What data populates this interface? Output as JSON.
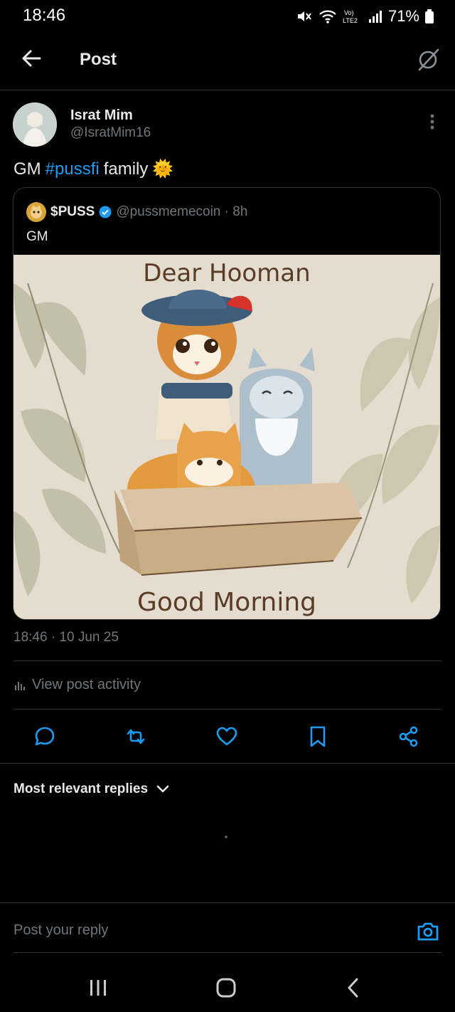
{
  "status_bar": {
    "time": "18:46",
    "battery": "71%",
    "network_label": "Vo) LTE2"
  },
  "header": {
    "title": "Post",
    "back_icon": "arrow-left-icon",
    "grok_icon": "grok-icon"
  },
  "post": {
    "author_name": "Israt Mim",
    "author_handle": "@IsratMim16",
    "text_before": "GM",
    "hashtag": "#pussfi",
    "text_after": "family",
    "emoji": "🌞",
    "timestamp": "18:46 · 10 Jun 25",
    "activity_label": "View post activity"
  },
  "quote": {
    "name": "$PUSS",
    "handle_time": "@pussmemecoin · 8h",
    "text": "GM",
    "image_title_top": "Dear Hooman",
    "image_title_bottom": "Good Morning"
  },
  "actions": [
    "reply-icon",
    "repost-icon",
    "like-icon",
    "bookmark-icon",
    "share-icon"
  ],
  "replies": {
    "sort_label": "Most relevant replies"
  },
  "composer": {
    "placeholder": "Post your reply"
  },
  "colors": {
    "accent": "#1d9bf0",
    "background": "#000000",
    "muted": "#71767b",
    "divider": "#2f3336"
  }
}
